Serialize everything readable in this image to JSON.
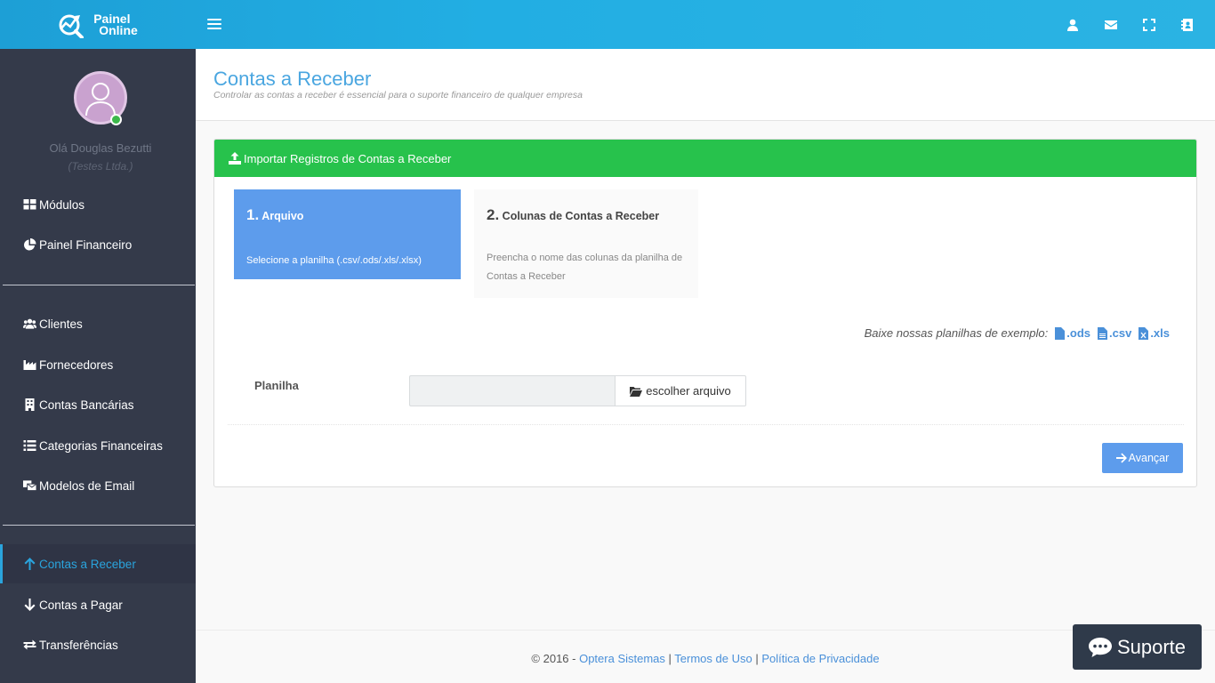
{
  "brand": {
    "line1": "Painel",
    "line2": "Online"
  },
  "topbar": {
    "icons": [
      "user-icon",
      "envelope-icon",
      "fullscreen-icon",
      "address-book-icon"
    ]
  },
  "user": {
    "greeting": "Olá Douglas Bezutti",
    "company": "(Testes Ltda.)",
    "status_color": "#3cb84a"
  },
  "sidebar": {
    "items": [
      {
        "label": "Módulos",
        "icon": "grid-icon"
      },
      {
        "label": "Painel Financeiro",
        "icon": "pie-chart-icon"
      },
      {
        "label": "Clientes",
        "icon": "users-icon"
      },
      {
        "label": "Fornecedores",
        "icon": "industry-icon"
      },
      {
        "label": "Contas Bancárias",
        "icon": "building-icon"
      },
      {
        "label": "Categorias Financeiras",
        "icon": "list-icon"
      },
      {
        "label": "Modelos de Email",
        "icon": "mail-template-icon"
      },
      {
        "label": "Contas a Receber",
        "icon": "arrow-up-icon",
        "active": true
      },
      {
        "label": "Contas a Pagar",
        "icon": "arrow-down-icon"
      },
      {
        "label": "Transferências",
        "icon": "exchange-icon"
      }
    ]
  },
  "page": {
    "title": "Contas a Receber",
    "subtitle": "Controlar as contas a receber é essencial para o suporte financeiro de qualquer empresa"
  },
  "panel": {
    "title": "Importar Registros de Contas a Receber",
    "steps": [
      {
        "num": "1.",
        "title": "Arquivo",
        "desc": "Selecione a planilha (.csv/.ods/.xls/.xlsx)"
      },
      {
        "num": "2.",
        "title": "Colunas de Contas a Receber",
        "desc": "Preencha o nome das colunas da planilha de Contas a Receber"
      }
    ],
    "examples_label": "Baixe nossas planilhas de exemplo:",
    "examples": [
      ".ods",
      ".csv",
      ".xls"
    ],
    "field_label": "Planilha",
    "file_input_value": "",
    "file_button": "escolher arquivo",
    "next_button": "Avançar"
  },
  "footer": {
    "copyright": "© 2016 - ",
    "company_link": "Optera Sistemas",
    "sep": " | ",
    "terms_link": "Termos de Uso",
    "privacy_link": "Política de Privacidade"
  },
  "support_button": "Suporte",
  "colors": {
    "primary": "#5d9cec",
    "header_green": "#27c24c",
    "sidebar_bg": "#343a4a",
    "topbar": "#22aee3"
  }
}
